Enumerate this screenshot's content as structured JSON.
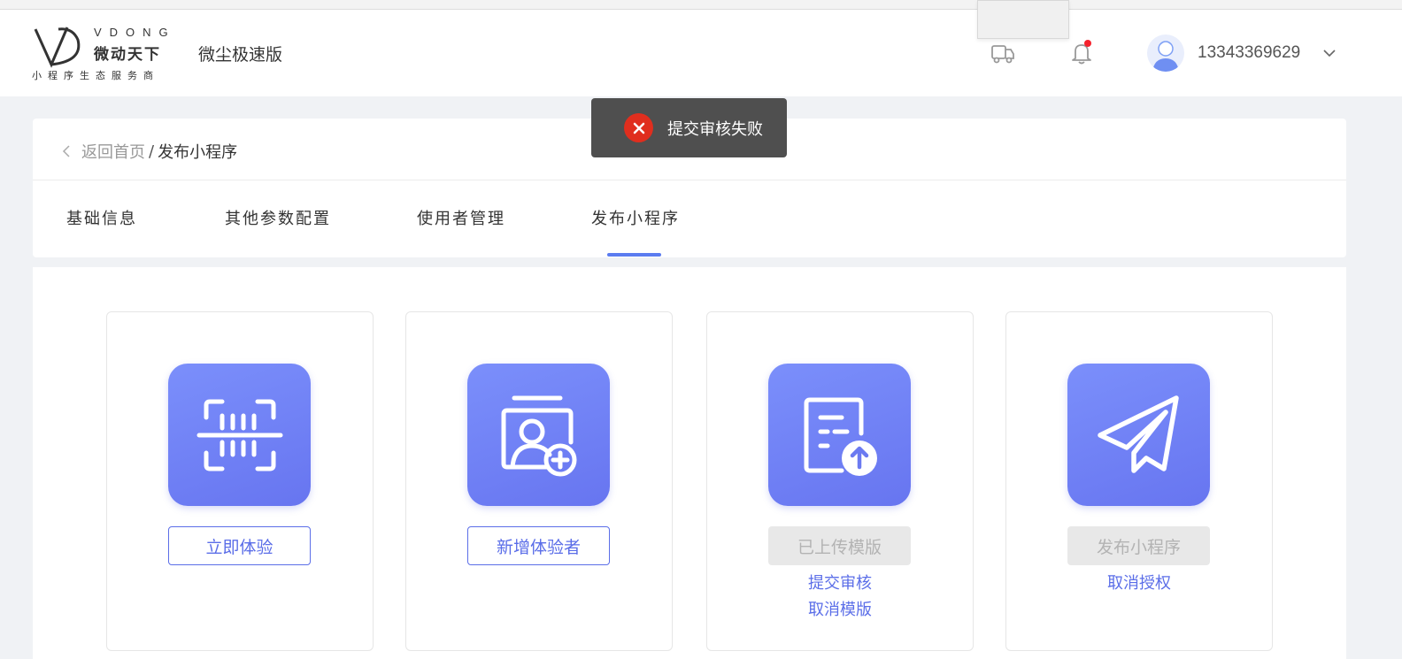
{
  "header": {
    "logo": {
      "top": "VDONG",
      "brand": "微动天下",
      "tagline": "小程序生态服务商"
    },
    "product_name": "微尘极速版",
    "username": "13343369629",
    "notification_dot_color": "#f5222d"
  },
  "breadcrumb": {
    "home": "返回首页",
    "separator": "/",
    "current": "发布小程序"
  },
  "tabs": [
    {
      "label": "基础信息"
    },
    {
      "label": "其他参数配置"
    },
    {
      "label": "使用者管理"
    },
    {
      "label": "发布小程序",
      "active": true
    }
  ],
  "steps": [
    {
      "icon": "scan-barcode-icon",
      "button": "立即体验",
      "button_state": "active"
    },
    {
      "icon": "add-user-icon",
      "button": "新增体验者",
      "button_state": "active"
    },
    {
      "icon": "upload-document-icon",
      "button": "已上传模版",
      "button_state": "disabled",
      "links": [
        "提交审核",
        "取消模版"
      ]
    },
    {
      "icon": "send-plane-icon",
      "button": "发布小程序",
      "button_state": "disabled",
      "links": [
        "取消授权"
      ]
    }
  ],
  "toast": {
    "message": "提交审核失败",
    "type": "error",
    "color": "#e02e1e"
  },
  "colors": {
    "accent": "#5b6ee8",
    "tab_indicator": "#5b7cf0"
  }
}
